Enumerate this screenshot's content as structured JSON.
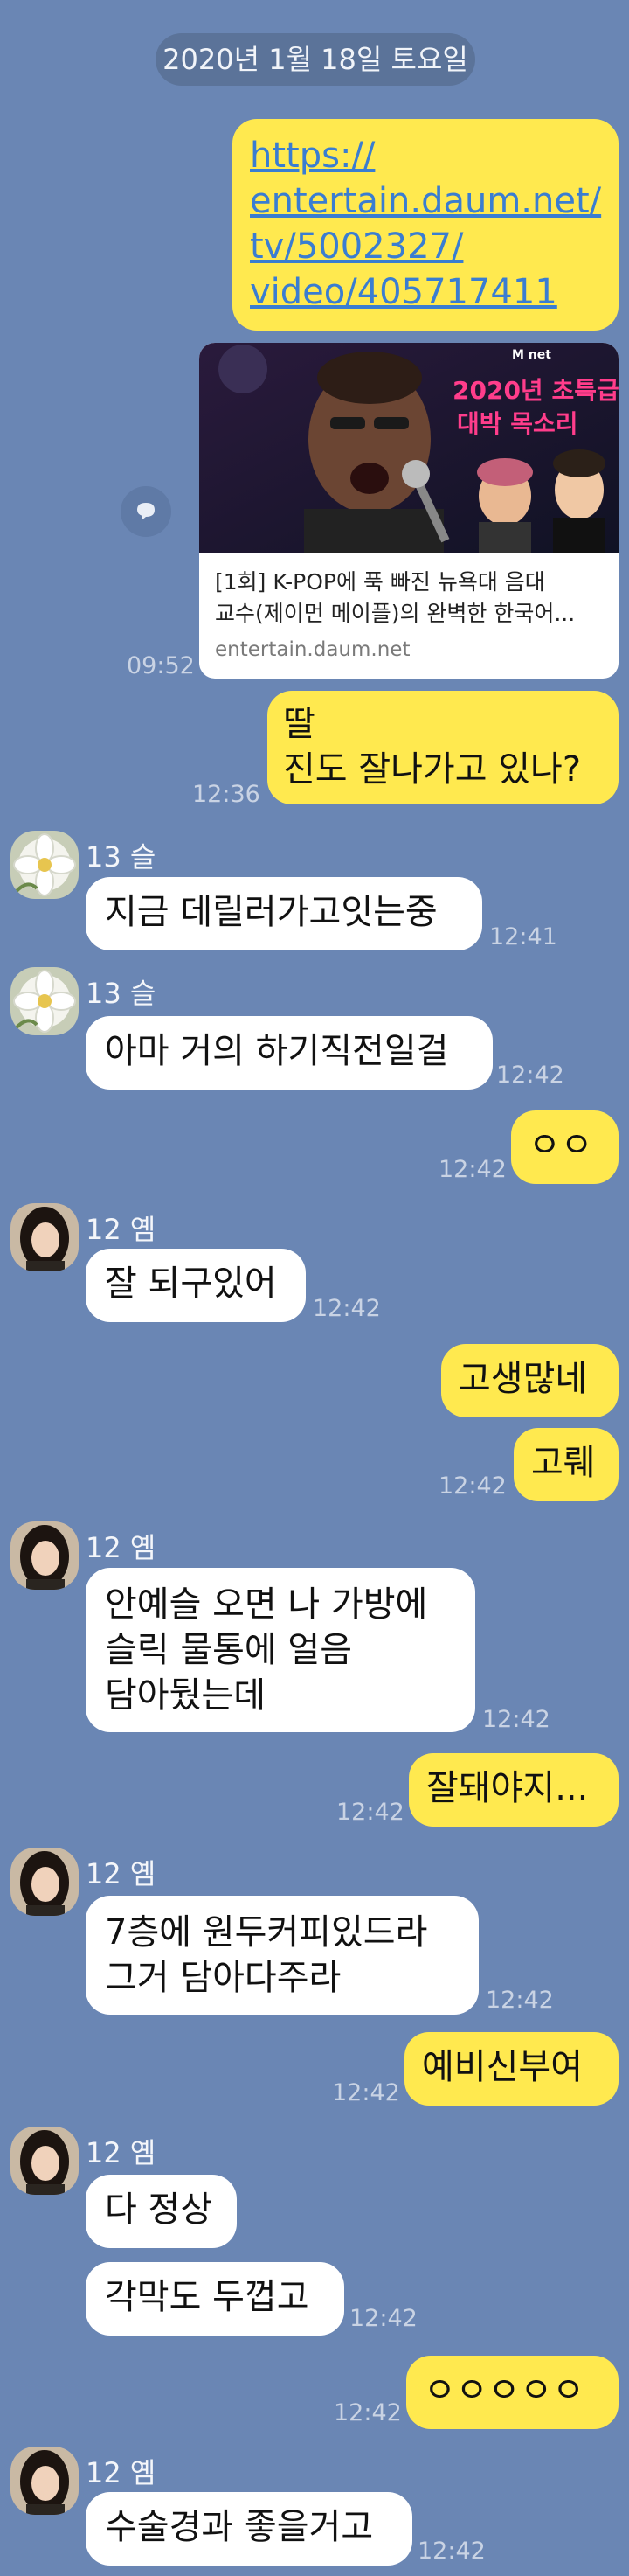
{
  "date_divider": "2020년 1월 18일 토요일",
  "link_message": {
    "url_lines": [
      "https://",
      "entertain.daum.net/",
      "tv/5002327/",
      "video/405717411"
    ],
    "card_title_1": "[1회] K-POP에 푹 빠진 뉴욕대 음대",
    "card_title_2": "교수(제이먼 메이플)의 완벽한 한국어...",
    "card_domain": "entertain.daum.net",
    "thumb_headline_1": "2020년 초특급",
    "thumb_headline_2": "대박 목소리",
    "thumb_channel": "M net",
    "time": "09:52"
  },
  "messages": [
    {
      "id": "m1",
      "lines": [
        "딸",
        "진도 잘나가고 있나?"
      ],
      "time": "12:36"
    },
    {
      "id": "m2",
      "sender": "13 슬",
      "lines": [
        "지금 데릴러가고잇는중"
      ],
      "time": "12:41"
    },
    {
      "id": "m3",
      "sender": "13 슬",
      "lines": [
        "아마 거의 하기직전일걸"
      ],
      "time": "12:42"
    },
    {
      "id": "m4",
      "lines": [
        "ㅇㅇ"
      ],
      "time": "12:42"
    },
    {
      "id": "m5",
      "sender": "12 옘",
      "lines": [
        "잘 되구있어"
      ],
      "time": "12:42"
    },
    {
      "id": "m6",
      "lines": [
        "고생많네"
      ]
    },
    {
      "id": "m7",
      "lines": [
        "고뤠"
      ],
      "time": "12:42"
    },
    {
      "id": "m8",
      "sender": "12 옘",
      "lines": [
        "안예슬 오면 나 가방에",
        "슬릭 물통에 얼음",
        "담아뒀는데"
      ],
      "time": "12:42"
    },
    {
      "id": "m9",
      "lines": [
        "잘돼야지..."
      ],
      "time": "12:42"
    },
    {
      "id": "m10",
      "sender": "12 옘",
      "lines": [
        "7층에 원두커피있드라",
        "그거 담아다주라"
      ],
      "time": "12:42"
    },
    {
      "id": "m11",
      "lines": [
        "예비신부여"
      ],
      "time": "12:42"
    },
    {
      "id": "m12",
      "sender": "12 옘",
      "lines": [
        "다 정상"
      ]
    },
    {
      "id": "m13",
      "lines": [
        "각막도 두껍고"
      ],
      "time": "12:42"
    },
    {
      "id": "m14",
      "lines": [
        "ㅇㅇㅇㅇㅇ"
      ],
      "time": "12:42"
    },
    {
      "id": "m15",
      "sender": "12 옘",
      "lines": [
        "수술경과 좋을거고"
      ],
      "time": "12:42"
    }
  ],
  "colors": {
    "background": "#6a86b4",
    "my_bubble": "#ffe94f",
    "other_bubble": "#ffffff",
    "link": "#3a7dd1"
  },
  "icons": [
    "share-icon",
    "flower-avatar",
    "woman-avatar"
  ]
}
